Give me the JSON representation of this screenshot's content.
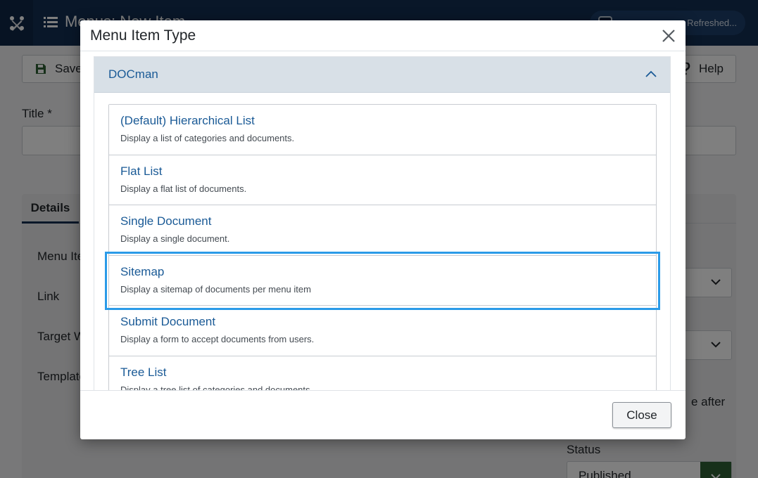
{
  "topbar": {
    "title": "Menus: New Item",
    "pill_text": "- Refreshed..."
  },
  "toolbar": {
    "save_label": "Save",
    "help_label": "Help"
  },
  "form": {
    "title_label": "Title *",
    "tabs": [
      {
        "label": "Details"
      }
    ],
    "fields": [
      {
        "label": "Menu Ite"
      },
      {
        "label": "Link"
      },
      {
        "label": "Target W"
      },
      {
        "label": "Template"
      }
    ],
    "after_text": "e after",
    "status_label": "Status",
    "status_value": "Published"
  },
  "modal": {
    "title": "Menu Item Type",
    "accordion_title": "DOCman",
    "items": [
      {
        "title": "(Default) Hierarchical List",
        "desc": "Display a list of categories and documents."
      },
      {
        "title": "Flat List",
        "desc": "Display a flat list of documents."
      },
      {
        "title": "Single Document",
        "desc": "Display a single document."
      },
      {
        "title": "Sitemap",
        "desc": "Display a sitemap of documents per menu item"
      },
      {
        "title": "Submit Document",
        "desc": "Display a form to accept documents from users."
      },
      {
        "title": "Tree List",
        "desc": "Display a tree list of categories and documents."
      }
    ],
    "selected_index": 3,
    "close_label": "Close"
  },
  "colors": {
    "topbar": "#132f53",
    "link": "#1a5a96",
    "accordion_header": "#d8e0e7",
    "focus_ring": "#2b9be8",
    "status_green": "#2f6134"
  },
  "icons": {
    "logo": "joomla-logo-icon",
    "menu": "list-icon",
    "save": "floppy-disk-icon",
    "help": "question-icon",
    "close": "close-icon",
    "accordion": "chevron-up-icon",
    "select": "chevron-down-icon"
  }
}
